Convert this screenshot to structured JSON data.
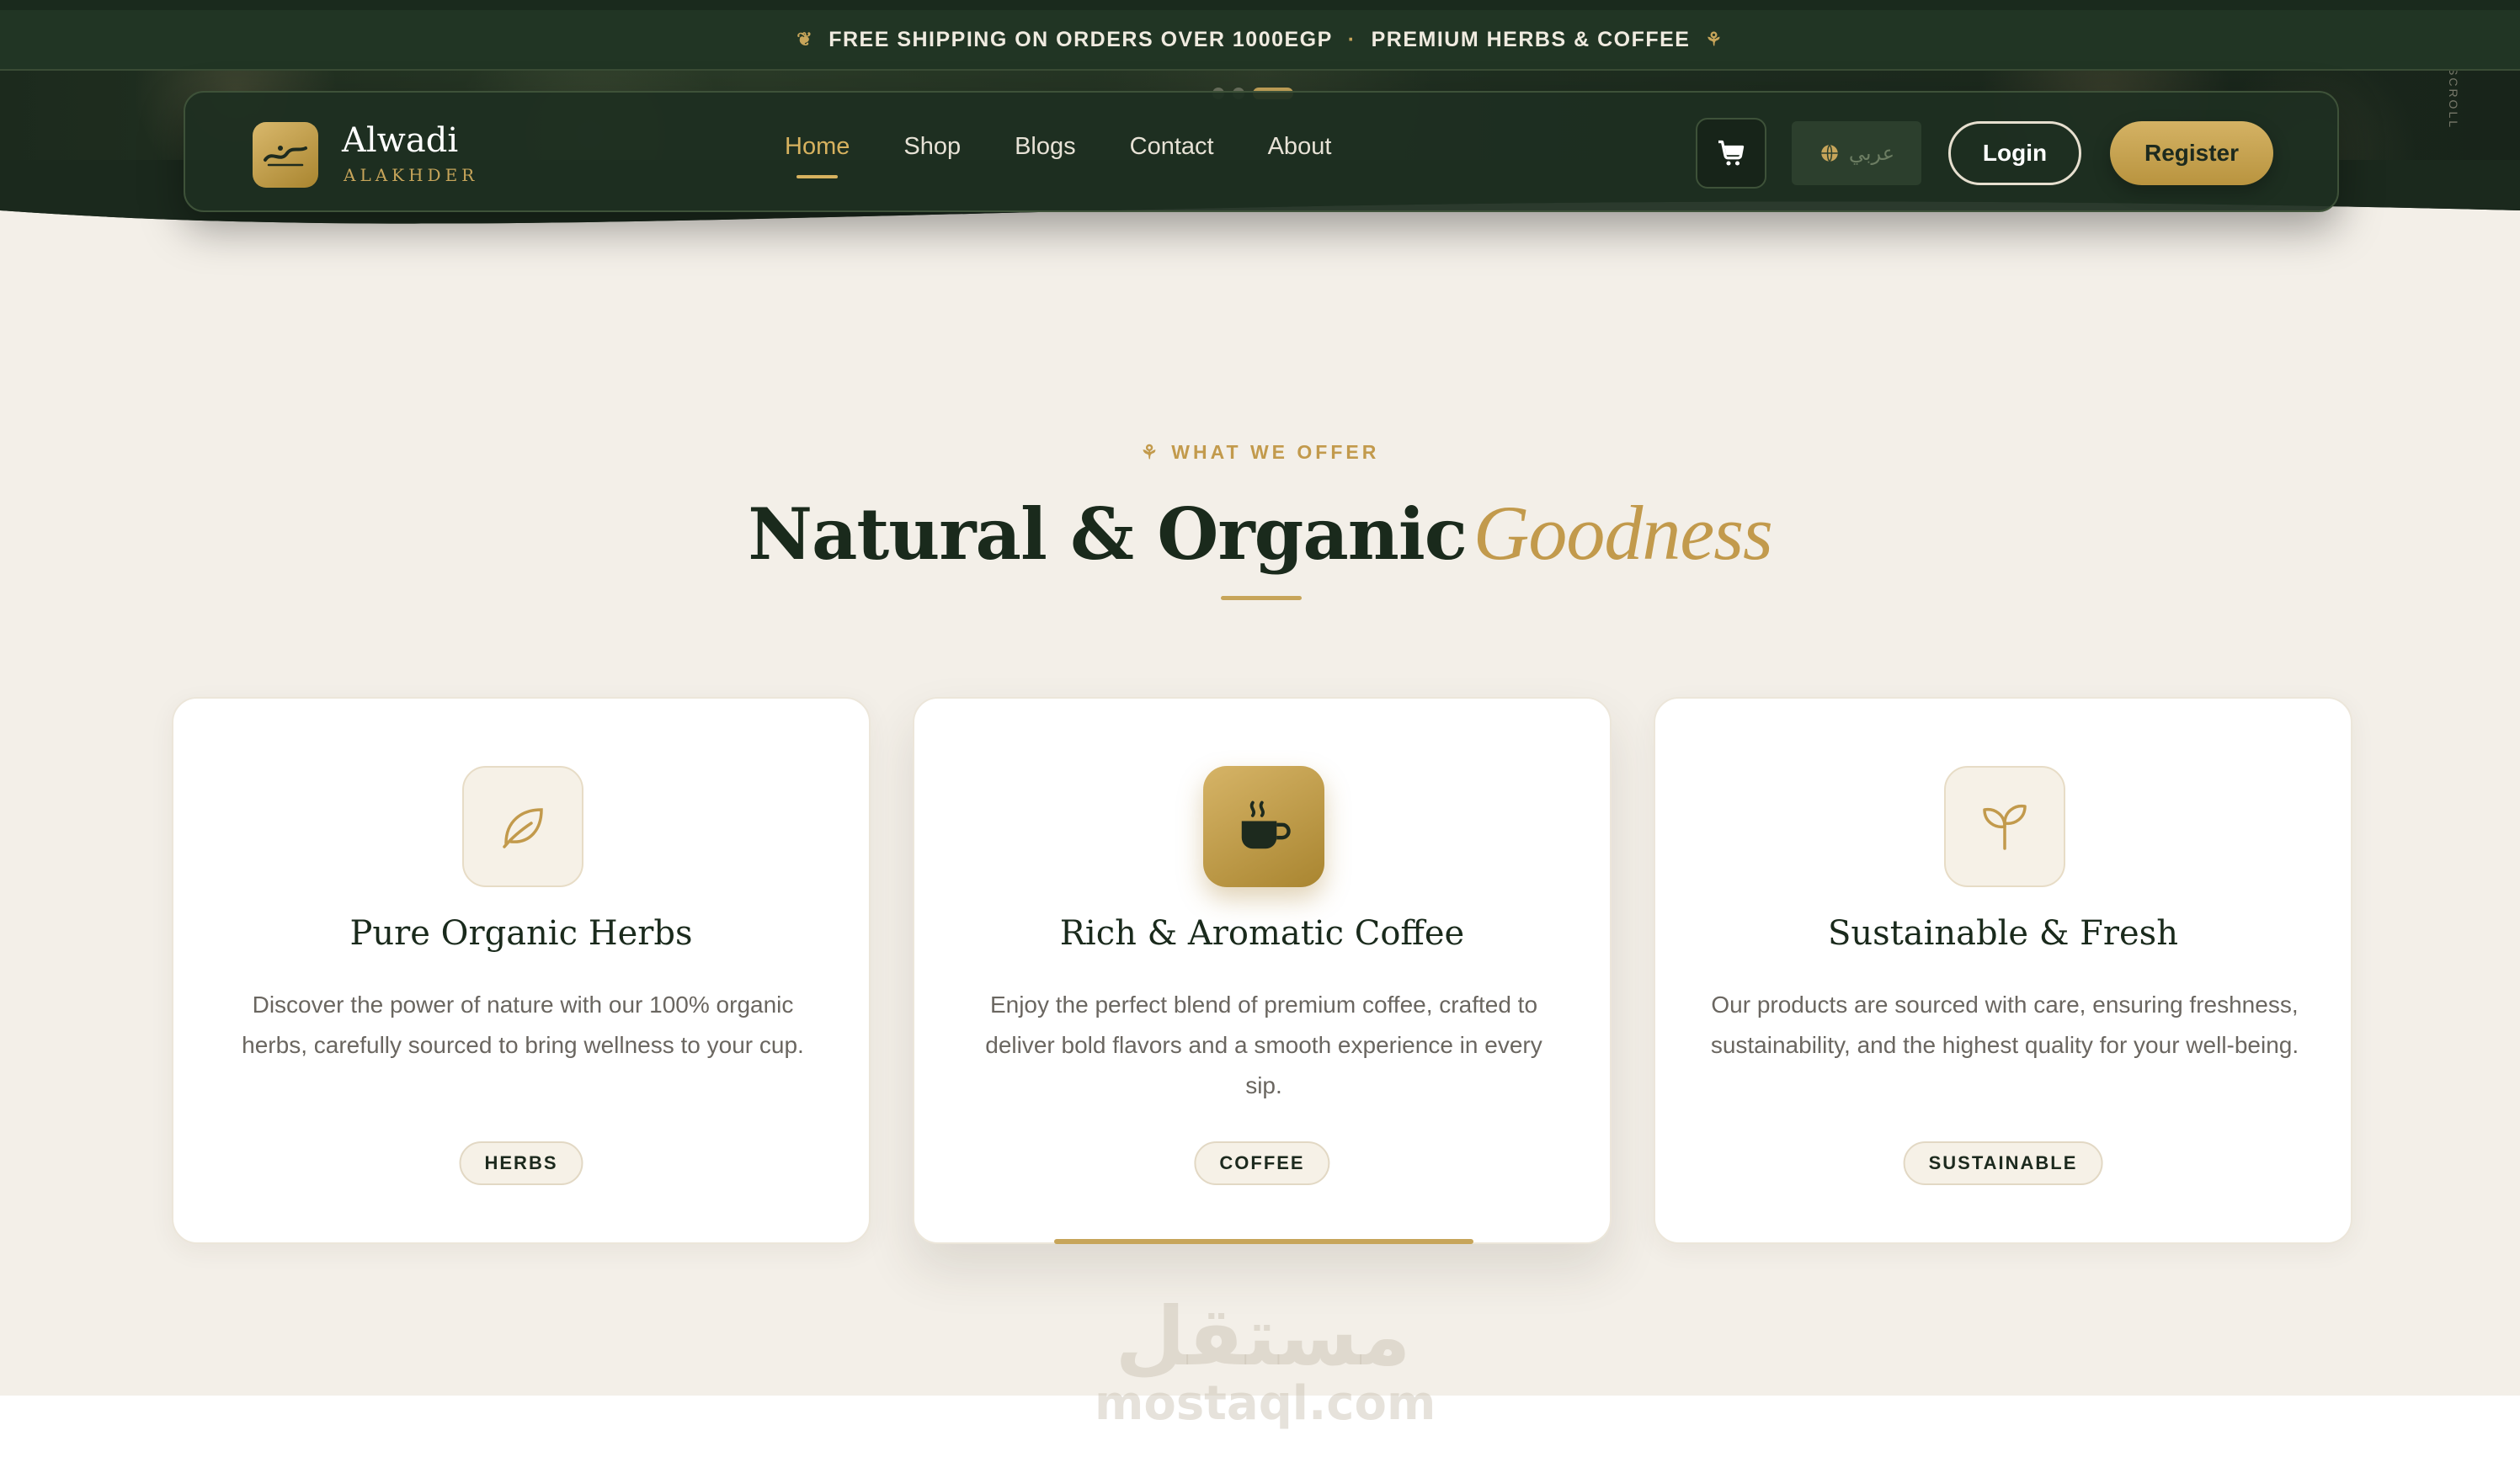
{
  "announcement": {
    "part1": "FREE SHIPPING ON ORDERS OVER 1000EGP",
    "separator": "·",
    "part2": "PREMIUM HERBS & COFFEE"
  },
  "hero": {
    "scroll_label": "SCROLL"
  },
  "brand": {
    "name": "Alwadi",
    "subtitle": "ALAKHDER"
  },
  "nav": {
    "links": [
      {
        "label": "Home",
        "active": true
      },
      {
        "label": "Shop",
        "active": false
      },
      {
        "label": "Blogs",
        "active": false
      },
      {
        "label": "Contact",
        "active": false
      },
      {
        "label": "About",
        "active": false
      }
    ],
    "language_label": "عربي",
    "login_label": "Login",
    "register_label": "Register"
  },
  "section": {
    "eyebrow": "WHAT WE OFFER",
    "title_main": "Natural & Organic",
    "title_accent": "Goodness"
  },
  "cards": [
    {
      "icon": "leaf-icon",
      "title": "Pure Organic Herbs",
      "text": "Discover the power of nature with our 100% organic herbs, carefully sourced to bring wellness to your cup.",
      "tag": "HERBS"
    },
    {
      "icon": "coffee-cup-icon",
      "title": "Rich & Aromatic Coffee",
      "text": "Enjoy the perfect blend of premium coffee, crafted to deliver bold flavors and a smooth experience in every sip.",
      "tag": "COFFEE"
    },
    {
      "icon": "sprout-icon",
      "title": "Sustainable & Fresh",
      "text": "Our products are sourced with care, ensuring freshness, sustainability, and the highest quality for your well-being.",
      "tag": "SUSTAINABLE"
    }
  ],
  "watermark": {
    "arabic": "مستقل",
    "latin": "mostaql.com"
  },
  "colors": {
    "dark_green": "#213524",
    "gold": "#c7a55a",
    "cream": "#f3efe8",
    "card_white": "#ffffff"
  }
}
